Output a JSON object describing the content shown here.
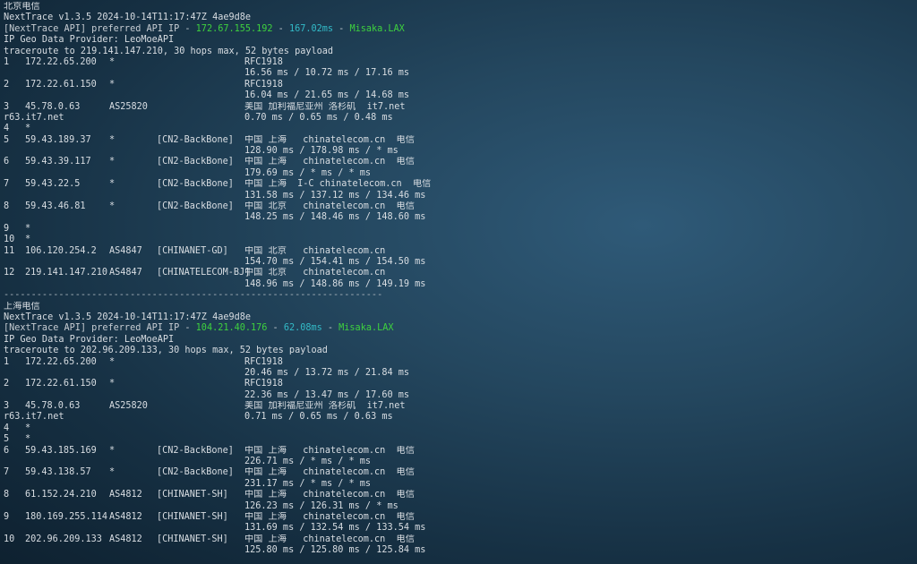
{
  "colors": {
    "accent_green": "#3ed13e",
    "accent_cyan": "#33bbc8",
    "text": "#d8dde2"
  },
  "sections": [
    {
      "title": "北京电信",
      "version_line": "NextTrace v1.3.5 2024-10-14T11:17:47Z 4ae9d8e",
      "api_prefix": "[NextTrace API] preferred API IP - ",
      "api_ip": "172.67.155.192",
      "api_latency": "167.02ms",
      "api_node": "Misaka.LAX",
      "geo_line": "IP Geo Data Provider: LeoMoeAPI",
      "trace_line": "traceroute to 219.141.147.210, 30 hops max, 52 bytes payload",
      "hops": [
        {
          "hop": "1",
          "ip": "172.22.65.200",
          "as": "*",
          "tag": "",
          "geo": "RFC1918",
          "rtt": "16.56 ms / 10.72 ms / 17.16 ms"
        },
        {
          "hop": "2",
          "ip": "172.22.61.150",
          "as": "*",
          "tag": "",
          "geo": "RFC1918",
          "rtt": "16.04 ms / 21.65 ms / 14.68 ms"
        },
        {
          "hop": "3",
          "ip": "45.78.0.63",
          "as": "AS25820",
          "tag": "",
          "geo": "美国 加利福尼亚州 洛杉矶  it7.net",
          "rtt": "0.70 ms / 0.65 ms / 0.48 ms",
          "host": "r63.it7.net"
        },
        {
          "hop": "4",
          "ip": "*",
          "as": "",
          "tag": "",
          "geo": "",
          "rtt": ""
        },
        {
          "hop": "5",
          "ip": "59.43.189.37",
          "as": "*",
          "tag": "[CN2-BackBone]",
          "geo": "中国 上海   chinatelecom.cn  电信",
          "rtt": "128.90 ms / 178.98 ms / * ms"
        },
        {
          "hop": "6",
          "ip": "59.43.39.117",
          "as": "*",
          "tag": "[CN2-BackBone]",
          "geo": "中国 上海   chinatelecom.cn  电信",
          "rtt": "179.69 ms / * ms / * ms"
        },
        {
          "hop": "7",
          "ip": "59.43.22.5",
          "as": "*",
          "tag": "[CN2-BackBone]",
          "geo": "中国 上海  I-C chinatelecom.cn  电信",
          "rtt": "131.58 ms / 137.12 ms / 134.46 ms"
        },
        {
          "hop": "8",
          "ip": "59.43.46.81",
          "as": "*",
          "tag": "[CN2-BackBone]",
          "geo": "中国 北京   chinatelecom.cn  电信",
          "rtt": "148.25 ms / 148.46 ms / 148.60 ms"
        },
        {
          "hop": "9",
          "ip": "*",
          "as": "",
          "tag": "",
          "geo": "",
          "rtt": ""
        },
        {
          "hop": "10",
          "ip": "*",
          "as": "",
          "tag": "",
          "geo": "",
          "rtt": ""
        },
        {
          "hop": "11",
          "ip": "106.120.254.2",
          "as": "AS4847",
          "tag": "[CHINANET-GD]",
          "geo": "中国 北京   chinatelecom.cn",
          "rtt": "154.70 ms / 154.41 ms / 154.50 ms"
        },
        {
          "hop": "12",
          "ip": "219.141.147.210",
          "as": "AS4847",
          "tag": "[CHINATELECOM-BJ]",
          "geo": "中国 北京   chinatelecom.cn",
          "rtt": "148.96 ms / 148.86 ms / 149.19 ms"
        }
      ]
    },
    {
      "title": "上海电信",
      "version_line": "NextTrace v1.3.5 2024-10-14T11:17:47Z 4ae9d8e",
      "api_prefix": "[NextTrace API] preferred API IP - ",
      "api_ip": "104.21.40.176",
      "api_latency": "62.08ms",
      "api_node": "Misaka.LAX",
      "geo_line": "IP Geo Data Provider: LeoMoeAPI",
      "trace_line": "traceroute to 202.96.209.133, 30 hops max, 52 bytes payload",
      "hops": [
        {
          "hop": "1",
          "ip": "172.22.65.200",
          "as": "*",
          "tag": "",
          "geo": "RFC1918",
          "rtt": "20.46 ms / 13.72 ms / 21.84 ms"
        },
        {
          "hop": "2",
          "ip": "172.22.61.150",
          "as": "*",
          "tag": "",
          "geo": "RFC1918",
          "rtt": "22.36 ms / 13.47 ms / 17.60 ms"
        },
        {
          "hop": "3",
          "ip": "45.78.0.63",
          "as": "AS25820",
          "tag": "",
          "geo": "美国 加利福尼亚州 洛杉矶  it7.net",
          "rtt": "0.71 ms / 0.65 ms / 0.63 ms",
          "host": "r63.it7.net"
        },
        {
          "hop": "4",
          "ip": "*",
          "as": "",
          "tag": "",
          "geo": "",
          "rtt": ""
        },
        {
          "hop": "5",
          "ip": "*",
          "as": "",
          "tag": "",
          "geo": "",
          "rtt": ""
        },
        {
          "hop": "6",
          "ip": "59.43.185.169",
          "as": "*",
          "tag": "[CN2-BackBone]",
          "geo": "中国 上海   chinatelecom.cn  电信",
          "rtt": "226.71 ms / * ms / * ms"
        },
        {
          "hop": "7",
          "ip": "59.43.138.57",
          "as": "*",
          "tag": "[CN2-BackBone]",
          "geo": "中国 上海   chinatelecom.cn  电信",
          "rtt": "231.17 ms / * ms / * ms"
        },
        {
          "hop": "8",
          "ip": "61.152.24.210",
          "as": "AS4812",
          "tag": "[CHINANET-SH]",
          "geo": "中国 上海   chinatelecom.cn  电信",
          "rtt": "126.23 ms / 126.31 ms / * ms"
        },
        {
          "hop": "9",
          "ip": "180.169.255.114",
          "as": "AS4812",
          "tag": "[CHINANET-SH]",
          "geo": "中国 上海   chinatelecom.cn  电信",
          "rtt": "131.69 ms / 132.54 ms / 133.54 ms"
        },
        {
          "hop": "10",
          "ip": "202.96.209.133",
          "as": "AS4812",
          "tag": "[CHINANET-SH]",
          "geo": "中国 上海   chinatelecom.cn  电信",
          "rtt": "125.80 ms / 125.80 ms / 125.84 ms"
        }
      ]
    }
  ],
  "separator": "---------------------------------------------------------------------"
}
